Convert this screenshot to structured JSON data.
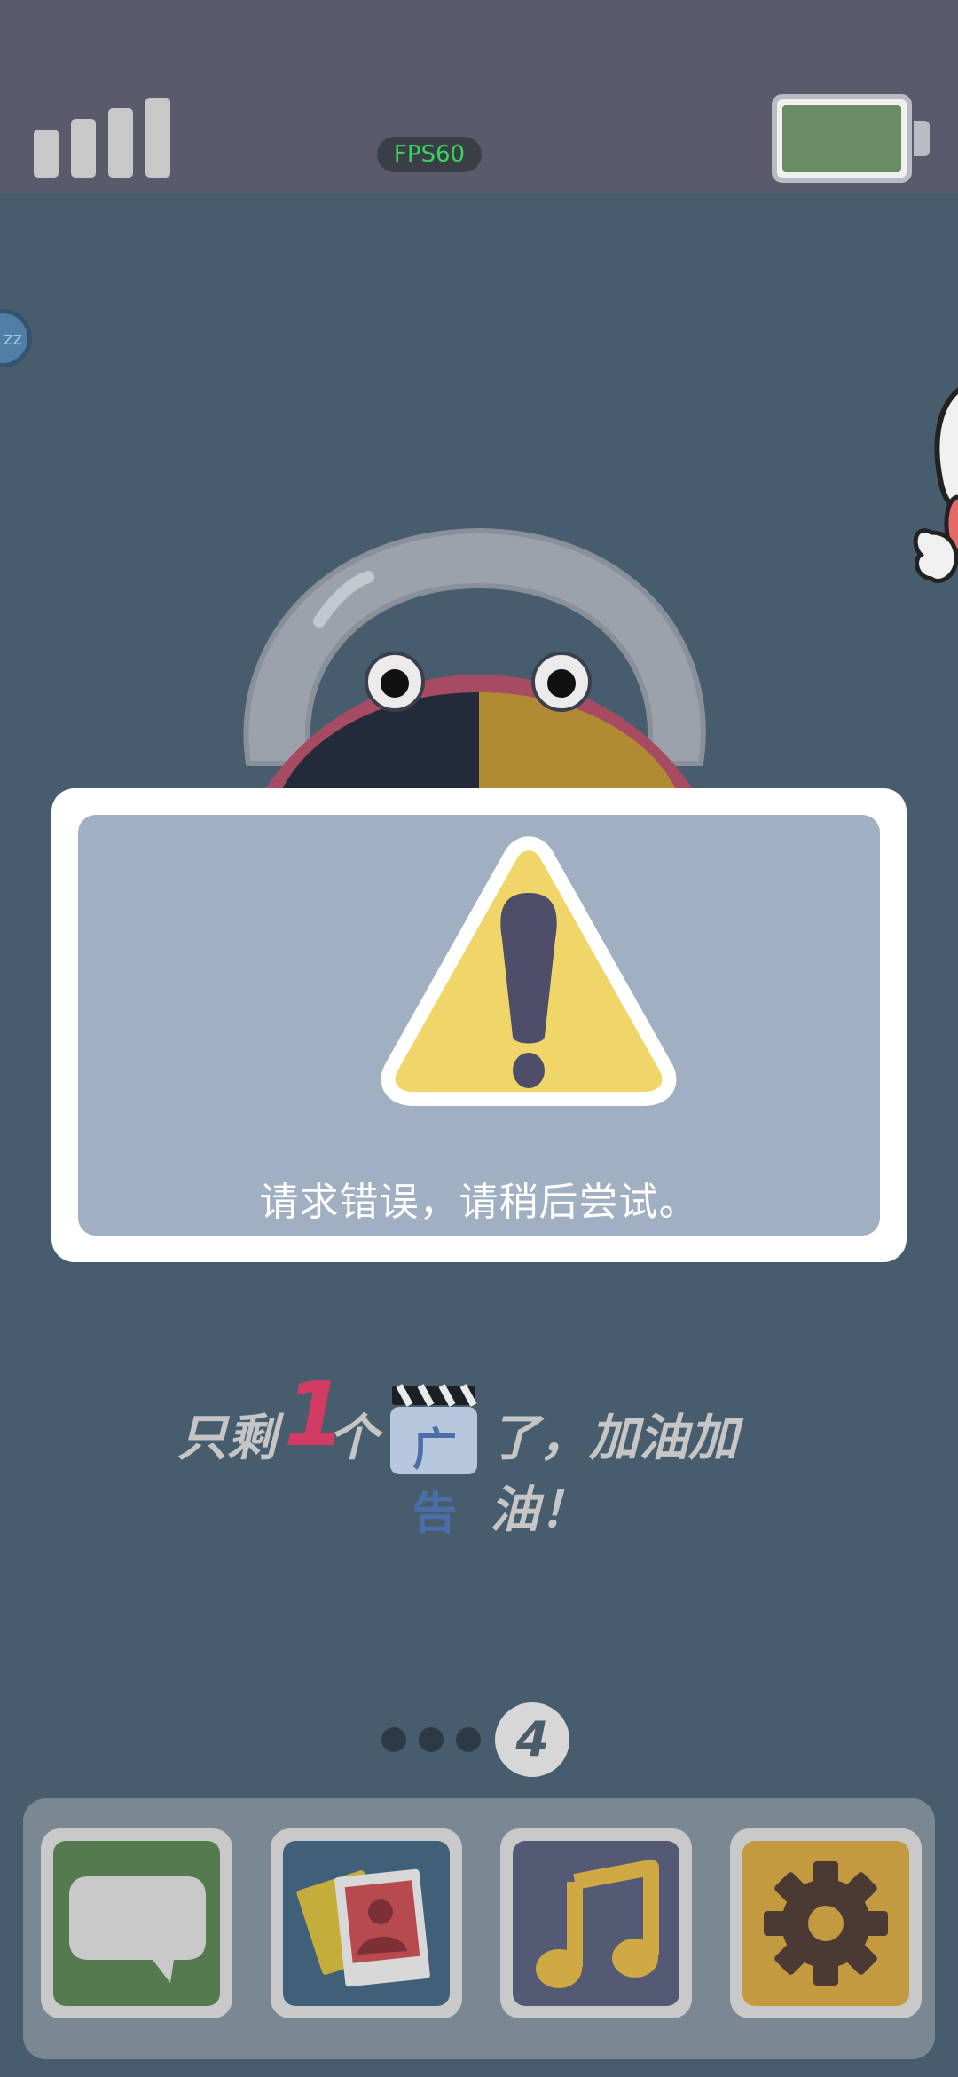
{
  "status_bar": {
    "fps_label": "FPS60",
    "signal_icon": "signal-bars-icon",
    "battery_icon": "battery-icon",
    "battery_level": 1.0,
    "battery_color": "#6a8c64"
  },
  "side": {
    "sleep_button_label": "zz"
  },
  "dialog": {
    "icon": "warning-icon",
    "message": "请求错误，请稍后尝试。"
  },
  "ad_info": {
    "prefix": "只剩",
    "count": "1",
    "measure": "个",
    "badge_label": "广告",
    "suffix": "了，加油加油！",
    "count_color": "#d23b64"
  },
  "pager": {
    "total_dots": 3,
    "current": "4"
  },
  "dock": {
    "buttons": [
      {
        "name": "chat",
        "icon": "chat-bubble-icon",
        "color": "#557a4f"
      },
      {
        "name": "gallery",
        "icon": "photo-icon",
        "color": "#3f6078"
      },
      {
        "name": "music",
        "icon": "music-note-icon",
        "color": "#555a74"
      },
      {
        "name": "settings",
        "icon": "gear-icon",
        "color": "#c39a3f"
      }
    ]
  }
}
